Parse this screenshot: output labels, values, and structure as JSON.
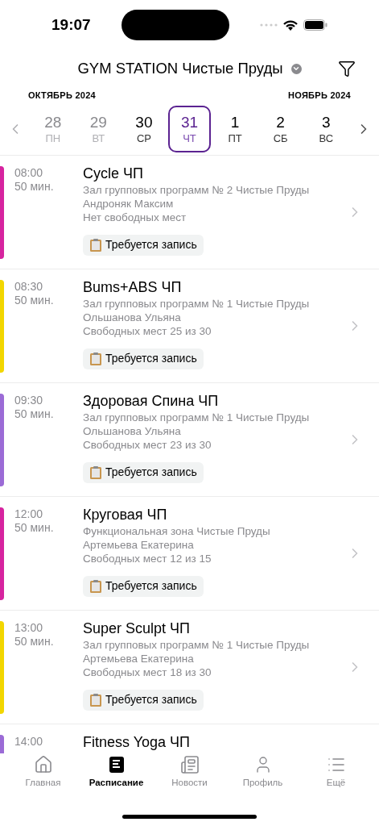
{
  "status_bar": {
    "time": "19:07"
  },
  "header": {
    "title": "GYM STATION Чистые Пруды"
  },
  "calendar": {
    "month_left": "ОКТЯБРЬ 2024",
    "month_right": "НОЯБРЬ 2024",
    "days": [
      {
        "number": "28",
        "weekday": "ПН",
        "past": true,
        "selected": false
      },
      {
        "number": "29",
        "weekday": "ВТ",
        "past": true,
        "selected": false
      },
      {
        "number": "30",
        "weekday": "СР",
        "past": false,
        "selected": false
      },
      {
        "number": "31",
        "weekday": "ЧТ",
        "past": false,
        "selected": true
      },
      {
        "number": "1",
        "weekday": "ПТ",
        "past": false,
        "selected": false
      },
      {
        "number": "2",
        "weekday": "СБ",
        "past": false,
        "selected": false
      },
      {
        "number": "3",
        "weekday": "ВС",
        "past": false,
        "selected": false
      }
    ]
  },
  "classes": [
    {
      "time": "08:00",
      "duration": "50 мин.",
      "title": "Cycle ЧП",
      "room": "Зал групповых программ № 2 Чистые Пруды",
      "trainer": "Андроняк Максим",
      "spots": "Нет свободных мест",
      "tag": "Требуется запись",
      "color": "#d6249f"
    },
    {
      "time": "08:30",
      "duration": "50 мин.",
      "title": "Bums+ABS ЧП",
      "room": "Зал групповых программ № 1 Чистые Пруды",
      "trainer": "Ольшанова Ульяна",
      "spots": "Свободных мест 25 из 30",
      "tag": "Требуется запись",
      "color": "#f2d600"
    },
    {
      "time": "09:30",
      "duration": "50 мин.",
      "title": "Здоровая Спина ЧП",
      "room": "Зал групповых программ № 1 Чистые Пруды",
      "trainer": "Ольшанова Ульяна",
      "spots": "Свободных мест 23 из 30",
      "tag": "Требуется запись",
      "color": "#9b6bd6"
    },
    {
      "time": "12:00",
      "duration": "50 мин.",
      "title": "Круговая ЧП",
      "room": "Функциональная зона Чистые Пруды",
      "trainer": "Артемьева Екатерина",
      "spots": "Свободных мест 12 из 15",
      "tag": "Требуется запись",
      "color": "#d6249f"
    },
    {
      "time": "13:00",
      "duration": "50 мин.",
      "title": "Super Sculpt ЧП",
      "room": "Зал групповых программ № 1 Чистые Пруды",
      "trainer": "Артемьева Екатерина",
      "spots": "Свободных мест 18 из 30",
      "tag": "Требуется запись",
      "color": "#f2d600"
    },
    {
      "time": "14:00",
      "title": "Fitness Yoga ЧП",
      "color": "#9b6bd6"
    }
  ],
  "tab_bar": [
    {
      "label": "Главная",
      "kind": "home",
      "selected": false
    },
    {
      "label": "Расписание",
      "kind": "schedule",
      "selected": true
    },
    {
      "label": "Новости",
      "kind": "news",
      "selected": false
    },
    {
      "label": "Профиль",
      "kind": "profile",
      "selected": false
    },
    {
      "label": "Ещё",
      "kind": "more",
      "selected": false
    }
  ]
}
